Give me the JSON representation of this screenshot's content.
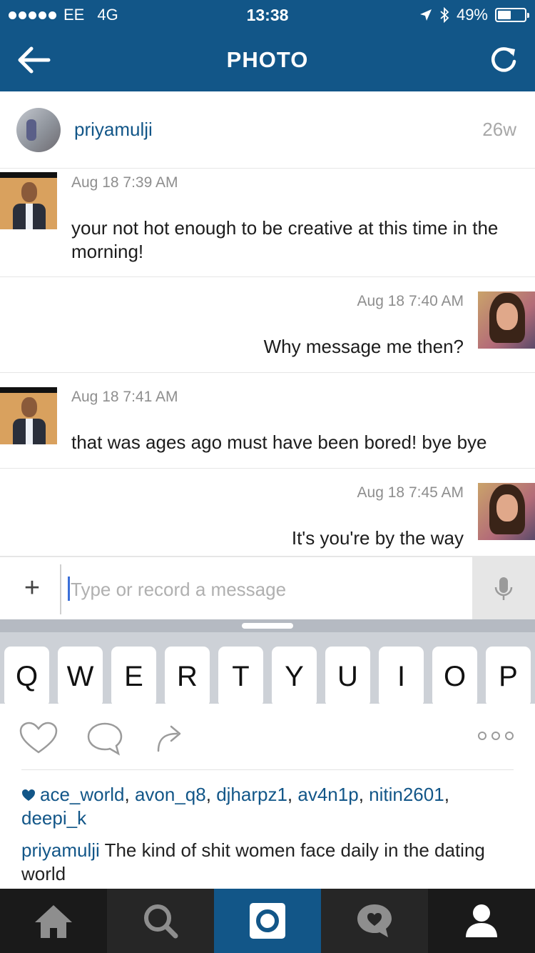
{
  "status_bar": {
    "carrier": "EE",
    "network": "4G",
    "time": "13:38",
    "battery": "49%",
    "battery_level": 0.49
  },
  "nav": {
    "title": "PHOTO",
    "back_icon": "back-arrow-icon",
    "refresh_icon": "refresh-icon"
  },
  "post": {
    "username": "priyamulji",
    "age": "26w"
  },
  "messages": [
    {
      "sender": "other",
      "time": "Aug 18 7:39 AM",
      "text": "your not hot enough to be creative at this time in the morning!"
    },
    {
      "sender": "self",
      "time": "Aug 18 7:40 AM",
      "text": "Why message me then?"
    },
    {
      "sender": "other",
      "time": "Aug 18 7:41 AM",
      "text": "that was ages ago must have been bored!  bye bye"
    },
    {
      "sender": "self",
      "time": "Aug 18 7:45 AM",
      "text": "It's you're by the way"
    }
  ],
  "composer": {
    "placeholder": "Type or record a message",
    "plus_label": "+"
  },
  "keyboard": {
    "keys": [
      "Q",
      "W",
      "E",
      "R",
      "T",
      "Y",
      "U",
      "I",
      "O",
      "P"
    ]
  },
  "likes": {
    "users": [
      "ace_world",
      "avon_q8",
      "djharpz1",
      "av4n1p",
      "nitin2601",
      "deepi_k"
    ]
  },
  "caption": {
    "username": "priyamulji",
    "text": "The kind of shit women face daily in the dating world"
  },
  "tabs": [
    "home",
    "explore",
    "camera",
    "activity",
    "profile"
  ],
  "colors": {
    "brand": "#125688",
    "tabbar": "#1a1a1a",
    "keyboard": "#cdd1d7"
  }
}
